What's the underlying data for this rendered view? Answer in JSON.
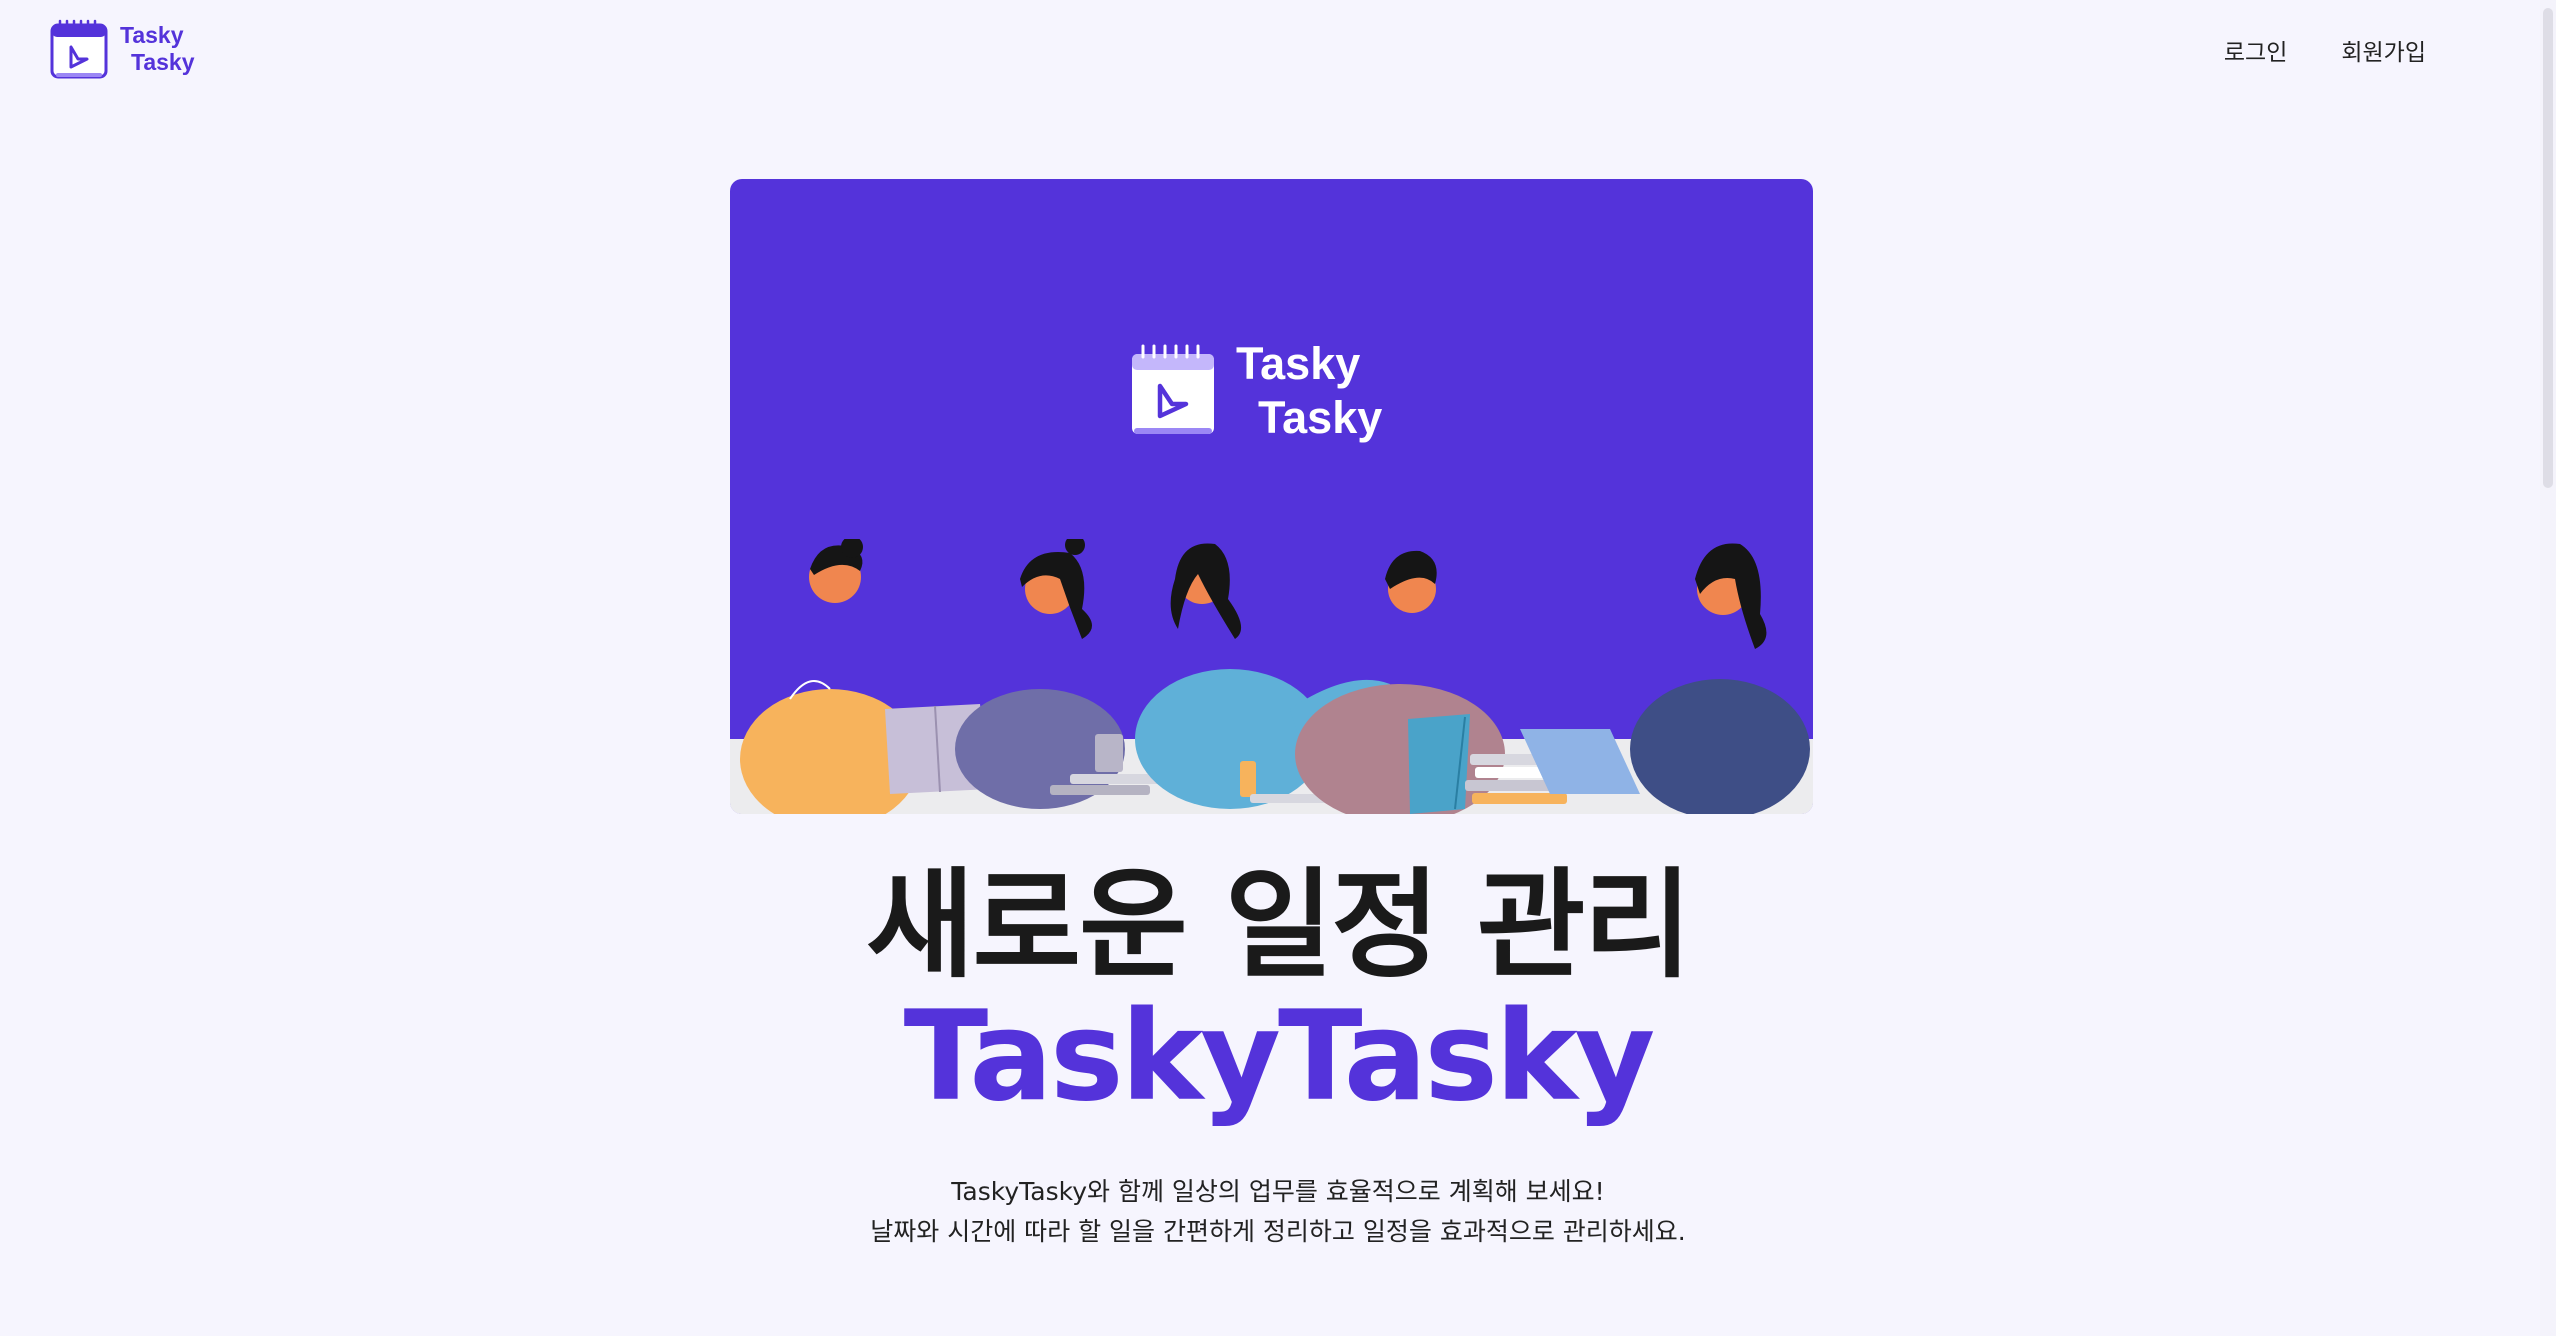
{
  "header": {
    "logo_line1": "Tasky",
    "logo_line2": "Tasky",
    "nav": {
      "login": "로그인",
      "signup": "회원가입"
    }
  },
  "hero": {
    "logo_line1": "Tasky",
    "logo_line2": "Tasky",
    "illustration": "people-working-together-illustration"
  },
  "main": {
    "title": "새로운 일정 관리",
    "brand": "TaskyTasky",
    "description": [
      "TaskyTasky와 함께 일상의 업무를 효율적으로 계획해 보세요!",
      "날짜와 시간에 따라 할 일을 간편하게 정리하고 일정을 효과적으로 관리하세요."
    ]
  },
  "colors": {
    "brand": "#5433da",
    "background": "#f6f5fe",
    "text": "#1a1a1a"
  },
  "icons": {
    "logo": "calendar-play-icon"
  }
}
